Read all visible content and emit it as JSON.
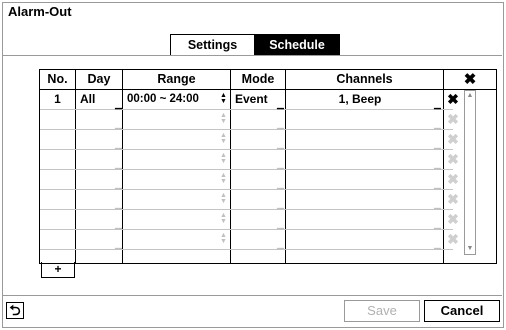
{
  "window": {
    "title": "Alarm-Out"
  },
  "tabs": [
    {
      "label": "Settings",
      "active": false
    },
    {
      "label": "Schedule",
      "active": true
    }
  ],
  "table": {
    "headers": {
      "no": "No.",
      "day": "Day",
      "range": "Range",
      "mode": "Mode",
      "channels": "Channels",
      "delete": "✖"
    },
    "rows": [
      {
        "no": "1",
        "day": "All",
        "range": "00:00 ~ 24:00",
        "mode": "Event",
        "channels": "1, Beep"
      }
    ],
    "empty_row_count": 7
  },
  "actions": {
    "add_label": "+",
    "back_icon": "back-arrow-icon",
    "back_glyph": "⮌",
    "save_label": "Save",
    "cancel_label": "Cancel"
  },
  "colors": {
    "active_tab_bg": "#000000",
    "disabled_text": "#b0b0b0",
    "border": "#9a9a9a"
  }
}
